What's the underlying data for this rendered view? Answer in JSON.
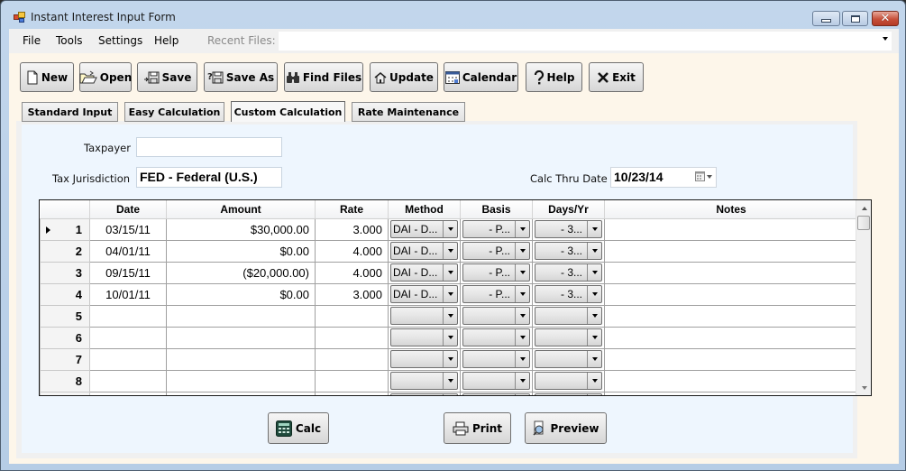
{
  "window": {
    "title": "Instant Interest Input Form",
    "controls": {
      "minimize": "minimize",
      "maximize": "maximize",
      "close": "✕"
    }
  },
  "menu": {
    "items": [
      "File",
      "Tools",
      "Settings",
      "Help"
    ],
    "recent_files_label": "Recent Files:",
    "recent_files_value": ""
  },
  "toolbar": {
    "buttons": [
      {
        "label": "New",
        "icon": "new-document-icon"
      },
      {
        "label": "Open",
        "icon": "open-folder-icon"
      },
      {
        "label": "Save",
        "icon": "save-disk-icon"
      },
      {
        "label": "Save As",
        "icon": "save-as-icon"
      },
      {
        "label": "Find Files",
        "icon": "binoculars-icon"
      },
      {
        "label": "Update",
        "icon": "update-house-icon"
      },
      {
        "label": "Calendar",
        "icon": "calendar-icon"
      },
      {
        "label": "Help",
        "icon": "question-icon"
      },
      {
        "label": "Exit",
        "icon": "exit-x-icon"
      }
    ]
  },
  "tabs": [
    {
      "label": "Standard Input",
      "active": false
    },
    {
      "label": "Easy Calculation",
      "active": false
    },
    {
      "label": "Custom Calculation",
      "active": true
    },
    {
      "label": "Rate Maintenance",
      "active": false
    }
  ],
  "form": {
    "taxpayer_label": "Taxpayer",
    "taxpayer_value": "",
    "jurisdiction_label": "Tax Jurisdiction",
    "jurisdiction_value": "FED - Federal (U.S.)",
    "calc_thru_label": "Calc Thru Date",
    "calc_thru_value": "10/23/14"
  },
  "grid": {
    "columns": [
      "Date",
      "Amount",
      "Rate",
      "Method",
      "Basis",
      "Days/Yr",
      "Notes"
    ],
    "rows": [
      {
        "num": "1",
        "date": "03/15/11",
        "amount": "$30,000.00",
        "rate": "3.000",
        "method": "DAI - D...",
        "basis": "- P...",
        "days": "- 3...",
        "notes": "",
        "current": true
      },
      {
        "num": "2",
        "date": "04/01/11",
        "amount": "$0.00",
        "rate": "4.000",
        "method": "DAI - D...",
        "basis": "- P...",
        "days": "- 3...",
        "notes": ""
      },
      {
        "num": "3",
        "date": "09/15/11",
        "amount": "($20,000.00)",
        "rate": "4.000",
        "method": "DAI - D...",
        "basis": "- P...",
        "days": "- 3...",
        "notes": ""
      },
      {
        "num": "4",
        "date": "10/01/11",
        "amount": "$0.00",
        "rate": "3.000",
        "method": "DAI - D...",
        "basis": "- P...",
        "days": "- 3...",
        "notes": ""
      },
      {
        "num": "5",
        "date": "",
        "amount": "",
        "rate": "",
        "method": "",
        "basis": "",
        "days": "",
        "notes": ""
      },
      {
        "num": "6",
        "date": "",
        "amount": "",
        "rate": "",
        "method": "",
        "basis": "",
        "days": "",
        "notes": ""
      },
      {
        "num": "7",
        "date": "",
        "amount": "",
        "rate": "",
        "method": "",
        "basis": "",
        "days": "",
        "notes": ""
      },
      {
        "num": "8",
        "date": "",
        "amount": "",
        "rate": "",
        "method": "",
        "basis": "",
        "days": "",
        "notes": ""
      },
      {
        "num": "",
        "date": "",
        "amount": "",
        "rate": "",
        "method": "",
        "basis": "",
        "days": "",
        "notes": ""
      }
    ]
  },
  "actions": {
    "calc_label": "Calc",
    "print_label": "Print",
    "preview_label": "Preview"
  }
}
